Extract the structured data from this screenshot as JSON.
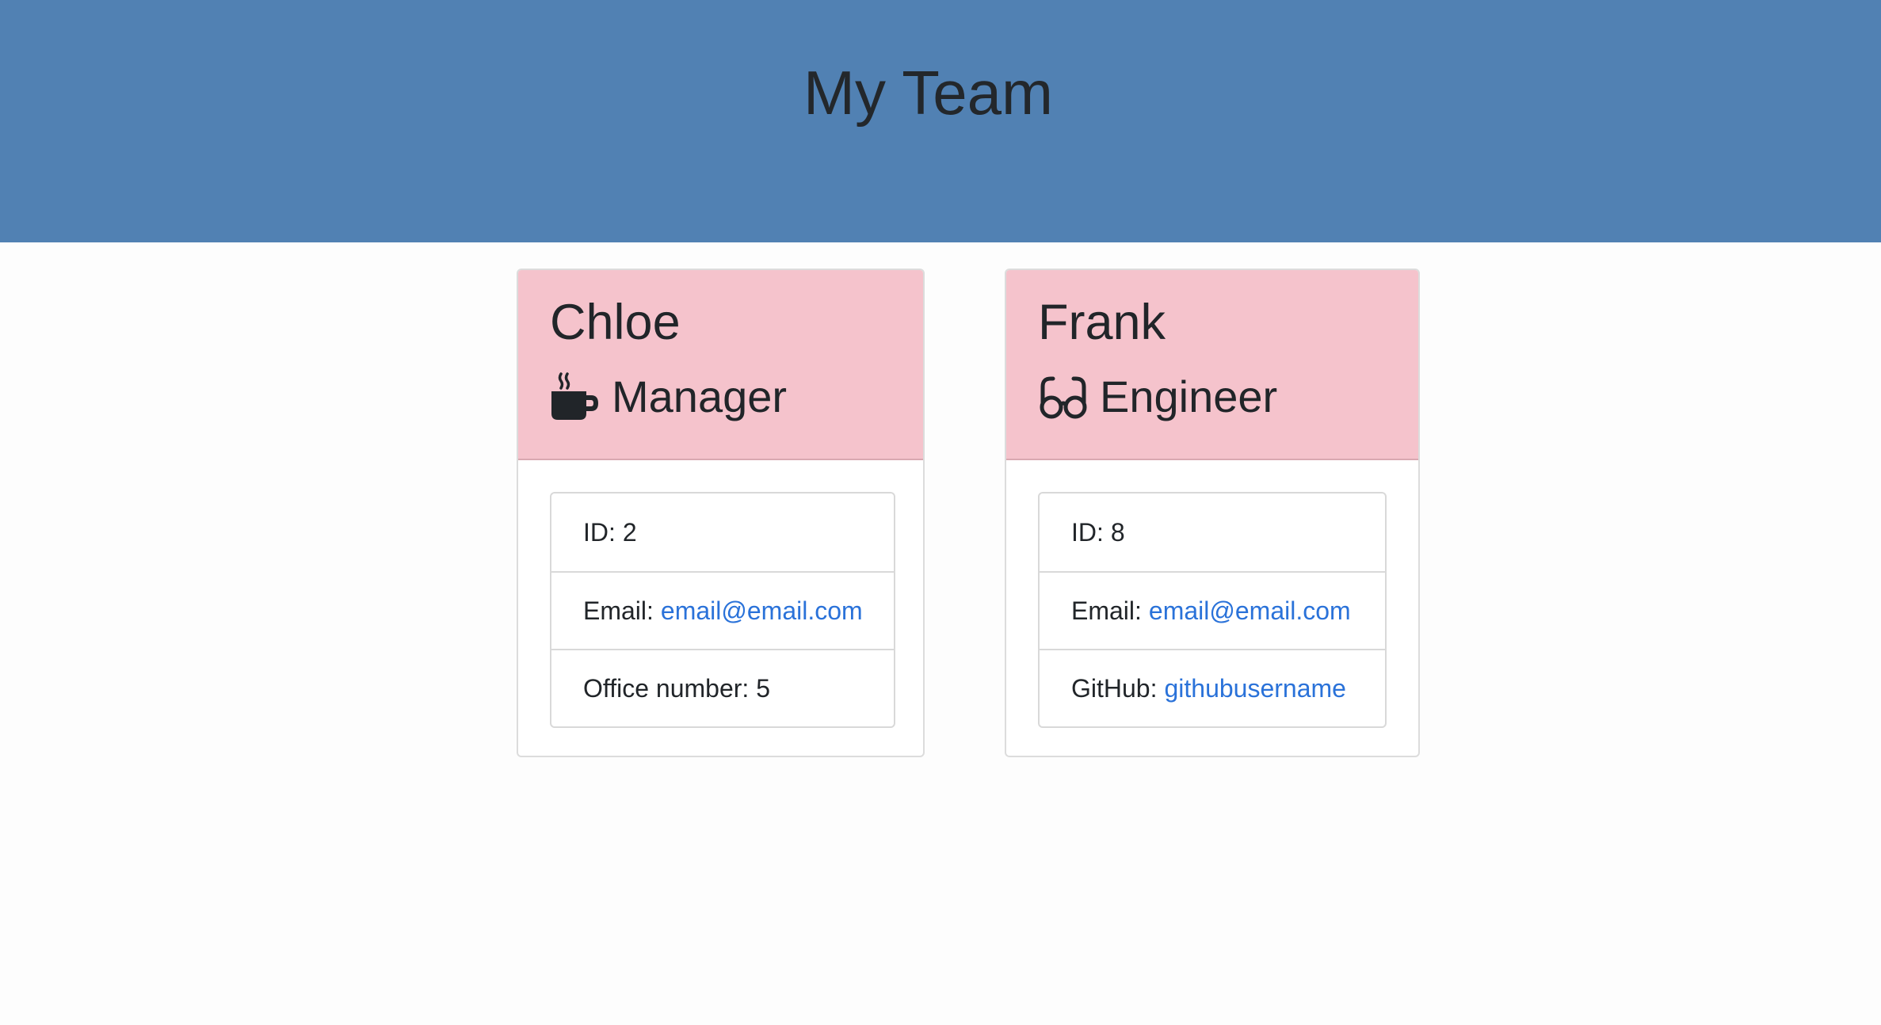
{
  "header": {
    "title": "My Team"
  },
  "colors": {
    "header_bg": "#5181b3",
    "card_header_bg": "#f5c3cc",
    "link": "#2a72d9"
  },
  "employees": [
    {
      "name": "Chloe",
      "role": "Manager",
      "role_icon": "coffee-mug-icon",
      "details": [
        {
          "label": "ID:",
          "value": "2"
        },
        {
          "label": "Email:",
          "value": "email@email.com",
          "is_link": true
        },
        {
          "label": "Office number:",
          "value": "5"
        }
      ]
    },
    {
      "name": "Frank",
      "role": "Engineer",
      "role_icon": "glasses-icon",
      "details": [
        {
          "label": "ID:",
          "value": "8"
        },
        {
          "label": "Email:",
          "value": "email@email.com",
          "is_link": true
        },
        {
          "label": "GitHub:",
          "value": "githubusername",
          "is_link": true
        }
      ]
    }
  ]
}
